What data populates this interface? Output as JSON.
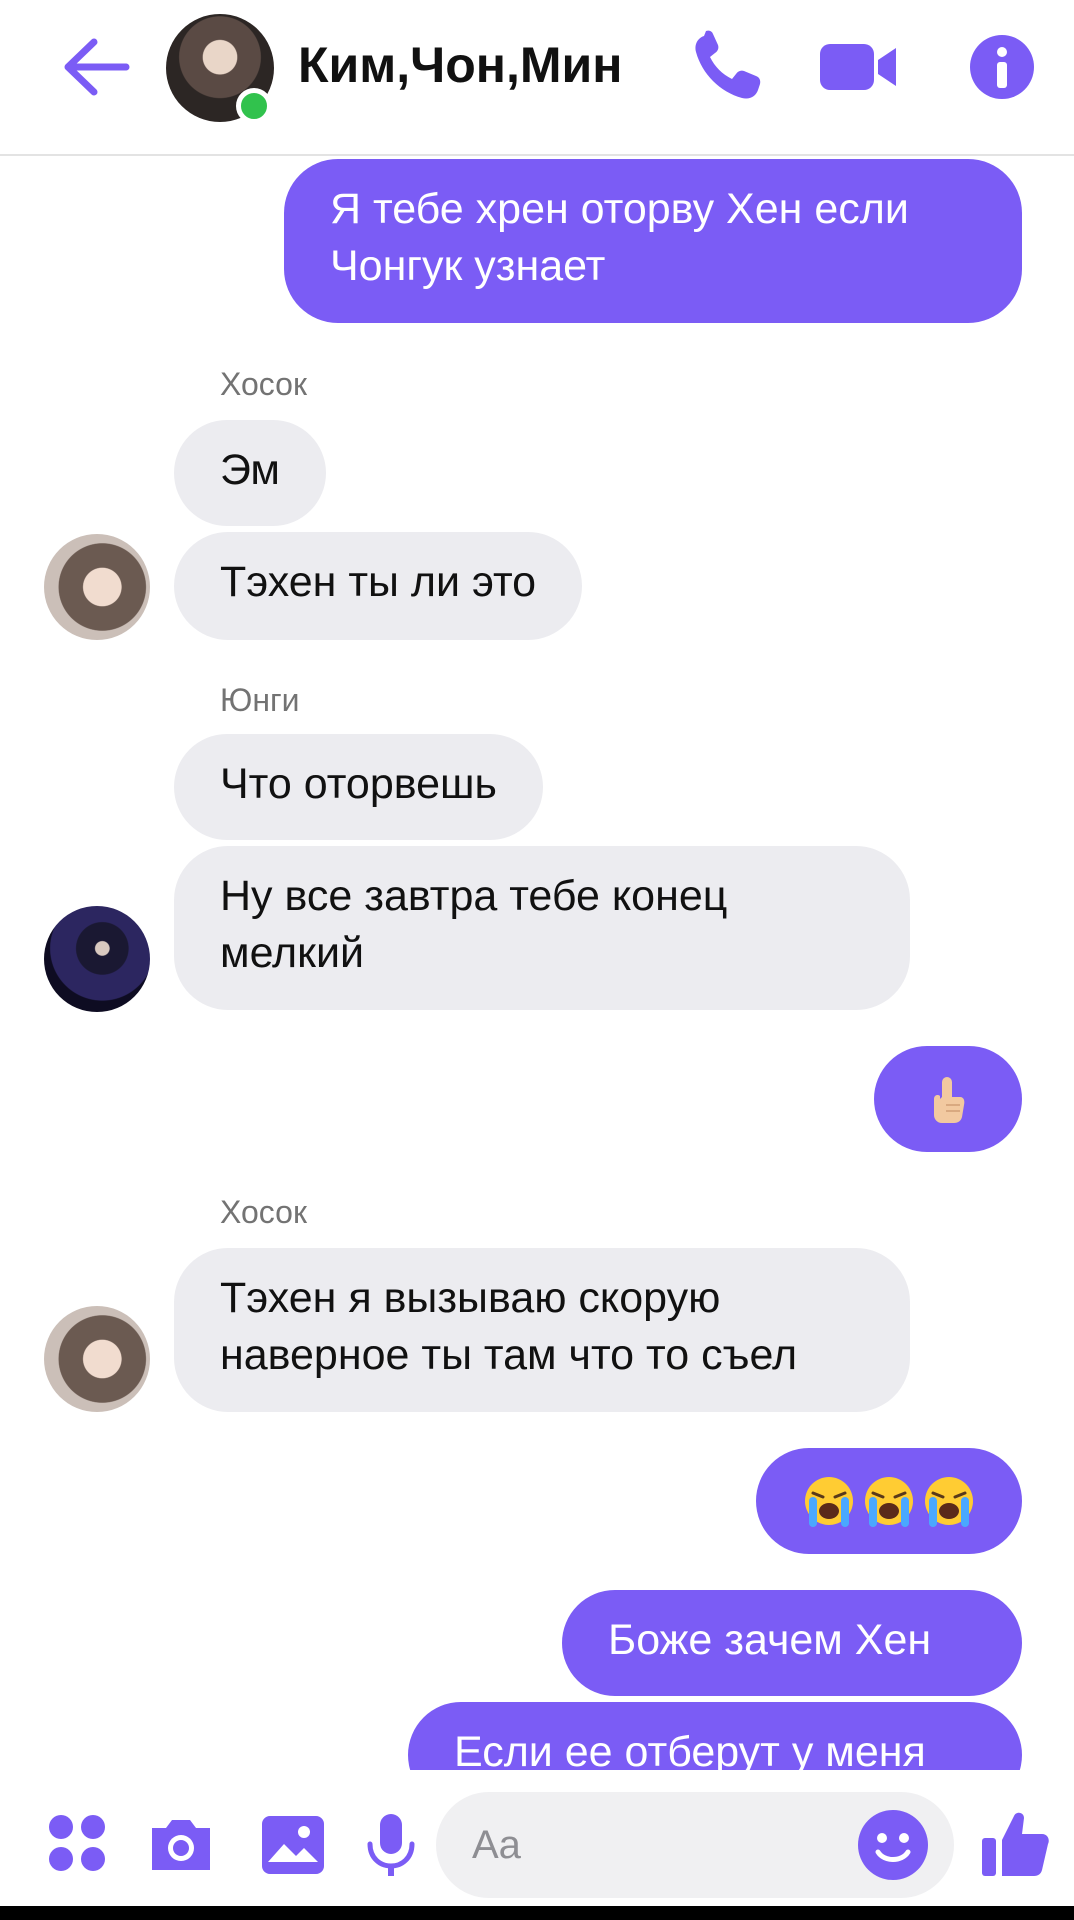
{
  "header": {
    "title": "Ким,Чон,Мин"
  },
  "messages": [
    {
      "id": "m1",
      "type": "outgoing",
      "text": "Я тебе хрен оторву Хен если\nЧонгук узнает"
    },
    {
      "id": "s1",
      "type": "sender",
      "name": "Хосок"
    },
    {
      "id": "m2",
      "type": "incoming",
      "text": "Эм"
    },
    {
      "id": "m3",
      "type": "incoming",
      "text": "Тэхен ты ли это"
    },
    {
      "id": "s2",
      "type": "sender",
      "name": "Юнги"
    },
    {
      "id": "m4",
      "type": "incoming",
      "text": "Что оторвешь"
    },
    {
      "id": "m5",
      "type": "incoming",
      "text": "Ну все завтра тебе конец\nмелкий"
    },
    {
      "id": "m6",
      "type": "outgoing-emoji",
      "emoji": "raised-index-finger-icon"
    },
    {
      "id": "s3",
      "type": "sender",
      "name": "Хосок"
    },
    {
      "id": "m7",
      "type": "incoming",
      "text": "Тэхен я вызываю скорую\nнаверное ты там что то съел"
    },
    {
      "id": "m8",
      "type": "outgoing-emoji",
      "emoji": "loudly-crying-face-icon",
      "count": 3
    },
    {
      "id": "m9",
      "type": "outgoing",
      "text": "Боже зачем Хен"
    },
    {
      "id": "m10",
      "type": "outgoing",
      "text": "Если ее отберут у меня"
    }
  ],
  "composer": {
    "placeholder": "Aa"
  },
  "colors": {
    "accent": "#7b5cf5",
    "incoming_bubble": "#ececf0",
    "online": "#31c24d"
  }
}
